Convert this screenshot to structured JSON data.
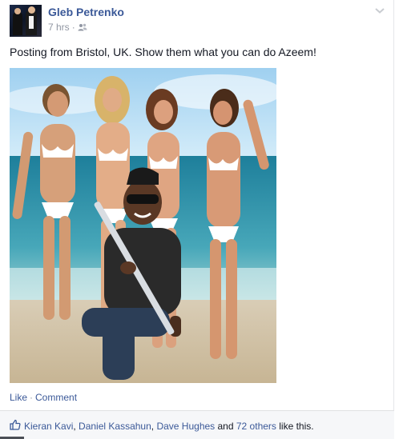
{
  "post": {
    "author": "Gleb Petrenko",
    "time": "7 hrs",
    "separator": "·",
    "audience_icon": "friends-icon",
    "message": "Posting from Bristol, UK. Show them what you can do Azeem!",
    "menu_icon": "chevron-down-icon"
  },
  "actions": {
    "like_label": "Like",
    "dot": "·",
    "comment_label": "Comment"
  },
  "likes": {
    "icon": "thumbs-up-icon",
    "people": [
      "Kieran Kavi",
      "Daniel Kassahun",
      "Dave Hughes"
    ],
    "sep1": ", ",
    "sep2": ", ",
    "and": " and ",
    "others": "72 others",
    "suffix": " like this."
  },
  "colors": {
    "link": "#3b5998",
    "meta": "#9197a3",
    "likes_bg": "#f6f7f9"
  }
}
